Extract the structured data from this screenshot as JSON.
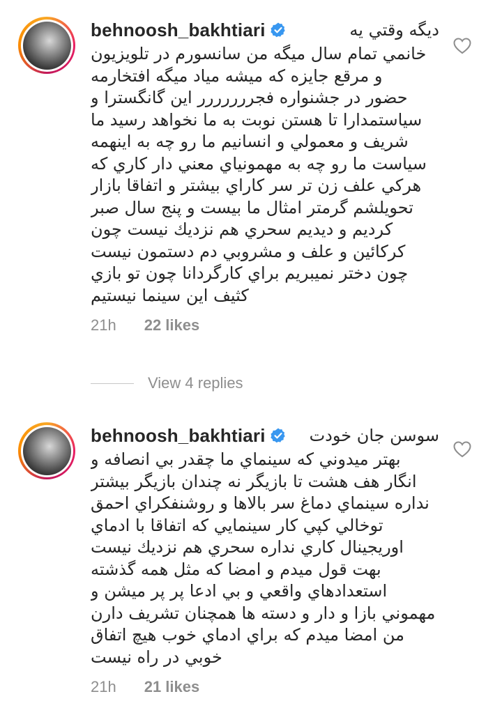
{
  "comments": [
    {
      "username": "behnoosh_bakhtiari",
      "verified": true,
      "first_line": "ديگه وقتي يه",
      "lines": [
        "خانمي تمام سال ميگه من سانسورم در تلويزيون",
        "و مرقع جايزه كه ميشه مياد ميگه افتخارمه",
        "حضور در جشنواره فجررررررر اين گانگسترا و",
        "سياستمدارا تا هستن نوبت به ما نخواهد رسيد ما",
        "شريف و معمولي و انسانيم ما رو چه به اينهمه",
        "سياست ما رو چه به مهمونياي معني دار كاري كه",
        "هركي علف زن تر سر كاراي بيشتر و اتفاقا بازار",
        "تحويلشم گرمتر امثال ما بيست و پنج سال صبر",
        "كرديم و ديديم سحري هم نزديك نيست چون",
        "كركائين و علف و مشروبي دم دستمون نيست",
        "چون دختر نميبريم براي كارگردانا چون تو بازي",
        "كثيف اين سينما نيستيم"
      ],
      "time": "21h",
      "likes": "22 likes"
    },
    {
      "username": "behnoosh_bakhtiari",
      "verified": true,
      "first_line": "سوسن جان خودت",
      "lines": [
        "بهتر ميدوني كه سينماي ما چقدر بي انصافه و",
        "انگار هف هشت تا بازيگر نه چندان بازيگر بيشتر",
        "نداره سينماي دماغ سر بالاها و روشنفكراي احمق",
        "توخالي كپي كار سينمايي كه اتفاقا با ادماي",
        "اوريجينال كاري نداره سحري هم نزديك نيست",
        "بهت قول ميدم و امضا كه مثل همه گذشته",
        "استعدادهاي واقعي و بي ادعا پر پر ميشن و",
        "مهموني بازا و دار و دسته ها همچنان تشريف دارن",
        "من امضا ميدم كه براي ادماي خوب هيچ اتفاق",
        "خوبي در راه نيست"
      ],
      "time": "21h",
      "likes": "21 likes"
    }
  ],
  "view_replies_label": "View 4 replies",
  "icons": {
    "like": "heart-outline-icon",
    "verified": "verified-badge-icon"
  },
  "colors": {
    "text": "#262626",
    "meta": "#8e8e8e",
    "verified": "#3897f0"
  }
}
